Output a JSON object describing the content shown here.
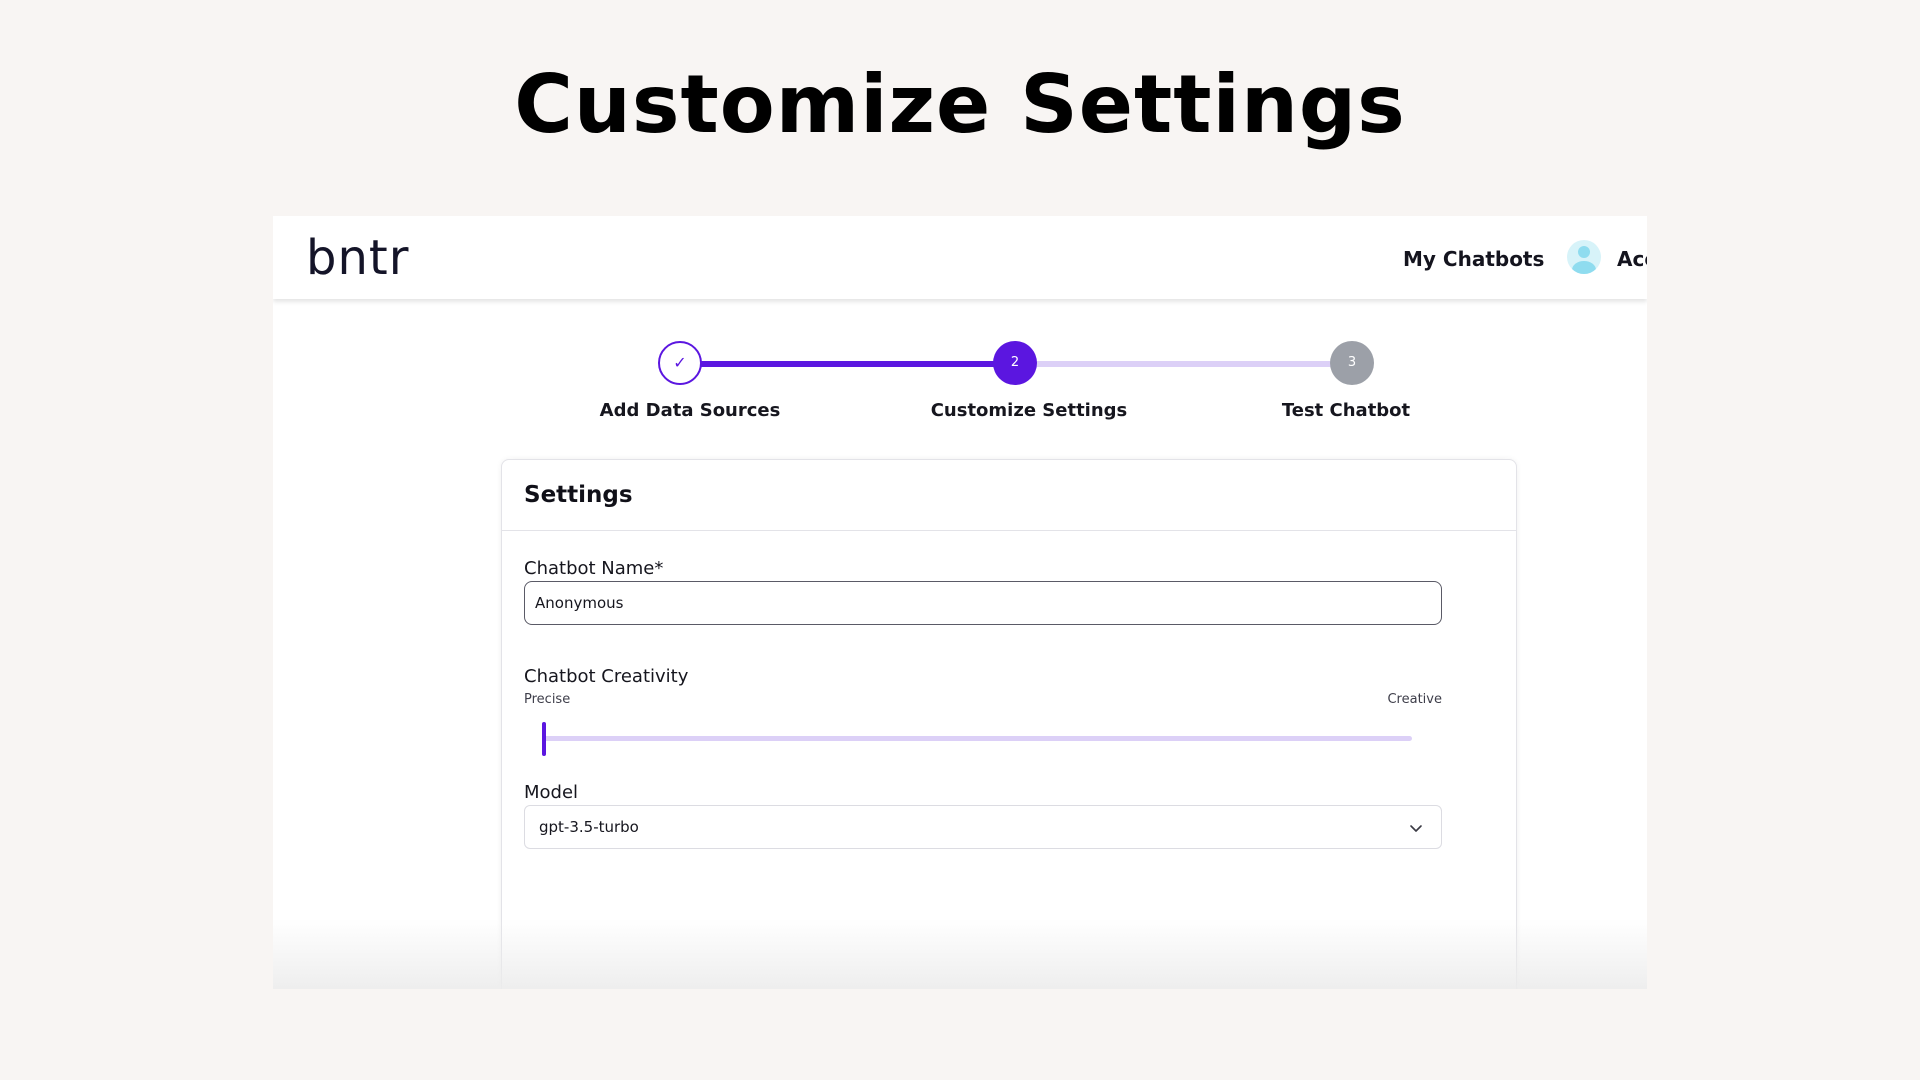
{
  "slide": {
    "title": "Customize Settings"
  },
  "navbar": {
    "logo": "bntr",
    "my_chatbots": "My Chatbots",
    "account": "Acc"
  },
  "stepper": {
    "steps": [
      {
        "number": "✓",
        "label": "Add Data Sources",
        "state": "complete"
      },
      {
        "number": "2",
        "label": "Customize Settings",
        "state": "current"
      },
      {
        "number": "3",
        "label": "Test Chatbot",
        "state": "upcoming"
      }
    ]
  },
  "settings": {
    "title": "Settings",
    "chatbot_name": {
      "label": "Chatbot Name*",
      "value": "Anonymous"
    },
    "creativity": {
      "label": "Chatbot Creativity",
      "min_label": "Precise",
      "max_label": "Creative",
      "value": 0
    },
    "model": {
      "label": "Model",
      "selected": "gpt-3.5-turbo"
    }
  },
  "colors": {
    "accent": "#5b16e0",
    "accent_light": "#dcd0f7",
    "upcoming_step": "#9ca0a8",
    "background": "#f8f5f3"
  }
}
